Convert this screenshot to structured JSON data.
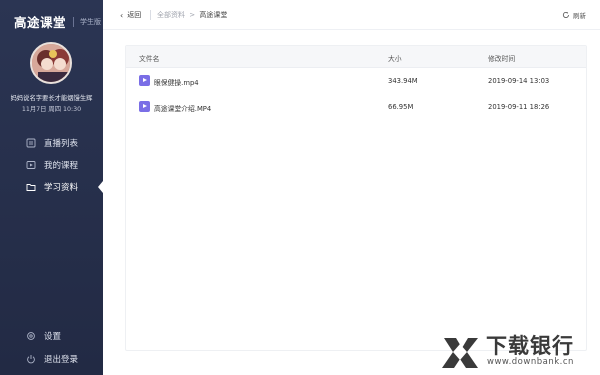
{
  "brand": {
    "name": "高途课堂",
    "tag": "学生版"
  },
  "user": {
    "name": "妈妈说名字要长才能烟馒生辉",
    "date": "11月7日 周四 10:30"
  },
  "nav": {
    "items": [
      {
        "label": "直播列表",
        "icon": "live-list-icon"
      },
      {
        "label": "我的课程",
        "icon": "play-icon"
      },
      {
        "label": "学习资料",
        "icon": "folder-icon",
        "active": true
      }
    ],
    "bottom": [
      {
        "label": "设置",
        "icon": "gear-icon"
      },
      {
        "label": "退出登录",
        "icon": "power-icon"
      }
    ]
  },
  "topbar": {
    "back_label": "返回",
    "breadcrumb": {
      "root": "全部资料",
      "separator": ">",
      "current": "高途课堂"
    },
    "refresh_label": "刷新"
  },
  "table": {
    "columns": [
      "文件名",
      "大小",
      "修改时间"
    ],
    "rows": [
      {
        "name": "眼保健操.mp4",
        "size": "343.94M",
        "modified": "2019-09-14 13:03",
        "icon": "video-file-icon"
      },
      {
        "name": "高途课堂介绍.MP4",
        "size": "66.95M",
        "modified": "2019-09-11 18:26",
        "icon": "video-file-icon"
      }
    ]
  },
  "watermark": {
    "text": "下载银行",
    "subtext": "www.downbank.cn"
  },
  "colors": {
    "sidebar": "#2b3553",
    "file_icon": "#7a6ee6",
    "header_bg": "#f6f7f9"
  }
}
